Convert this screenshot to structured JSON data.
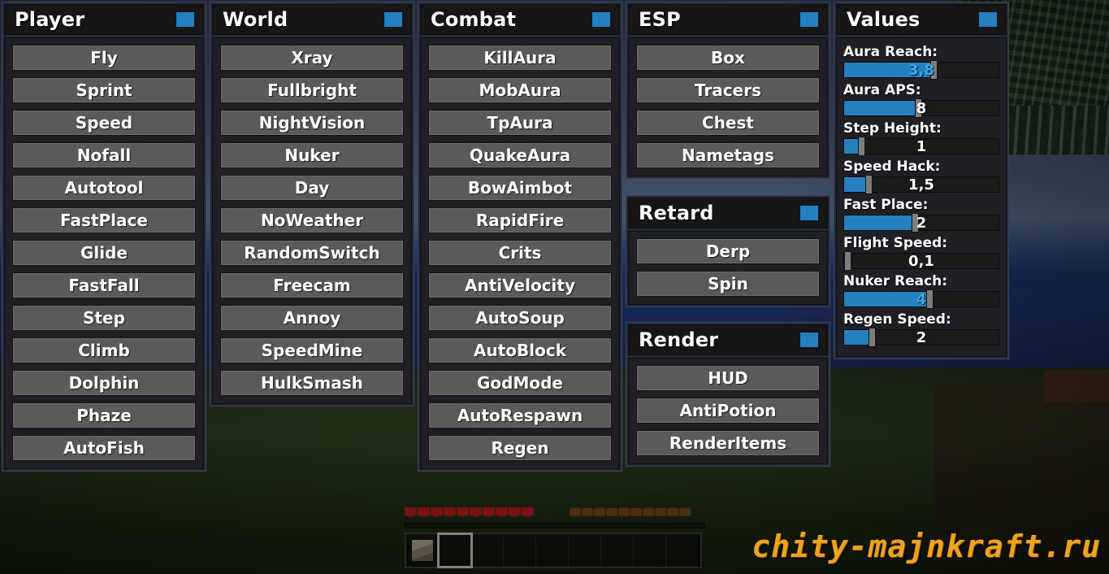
{
  "watermark": "chity-majnkraft.ru",
  "accent_color": "#2580c0",
  "panels": [
    {
      "id": "player",
      "title": "Player",
      "toggle_icon": "toggle-square-icon",
      "enabled": true,
      "modules": [
        "Fly",
        "Sprint",
        "Speed",
        "Nofall",
        "Autotool",
        "FastPlace",
        "Glide",
        "FastFall",
        "Step",
        "Climb",
        "Dolphin",
        "Phaze",
        "AutoFish"
      ]
    },
    {
      "id": "world",
      "title": "World",
      "toggle_icon": "toggle-square-icon",
      "enabled": true,
      "modules": [
        "Xray",
        "Fullbright",
        "NightVision",
        "Nuker",
        "Day",
        "NoWeather",
        "RandomSwitch",
        "Freecam",
        "Annoy",
        "SpeedMine",
        "HulkSmash"
      ]
    },
    {
      "id": "combat",
      "title": "Combat",
      "toggle_icon": "toggle-square-icon",
      "enabled": true,
      "modules": [
        "KillAura",
        "MobAura",
        "TpAura",
        "QuakeAura",
        "BowAimbot",
        "RapidFire",
        "Crits",
        "AntiVelocity",
        "AutoSoup",
        "AutoBlock",
        "GodMode",
        "AutoRespawn",
        "Regen"
      ]
    },
    {
      "id": "esp",
      "title": "ESP",
      "toggle_icon": "toggle-square-icon",
      "enabled": true,
      "modules": [
        "Box",
        "Tracers",
        "Chest",
        "Nametags"
      ]
    },
    {
      "id": "retard",
      "title": "Retard",
      "toggle_icon": "toggle-square-icon",
      "enabled": true,
      "modules": [
        "Derp",
        "Spin"
      ]
    },
    {
      "id": "render",
      "title": "Render",
      "toggle_icon": "toggle-square-icon",
      "enabled": true,
      "modules": [
        "HUD",
        "AntiPotion",
        "RenderItems"
      ]
    }
  ],
  "values_panel": {
    "title": "Values",
    "toggle_icon": "toggle-square-icon",
    "enabled": true,
    "sliders": [
      {
        "label": "Aura Reach:",
        "value": "3,8",
        "fill_percent": 58,
        "highlighted": true
      },
      {
        "label": "Aura APS:",
        "value": "8",
        "fill_percent": 48,
        "highlighted": false
      },
      {
        "label": "Step Height:",
        "value": "1",
        "fill_percent": 11,
        "highlighted": false
      },
      {
        "label": "Speed Hack:",
        "value": "1,5",
        "fill_percent": 16,
        "highlighted": false
      },
      {
        "label": "Fast Place:",
        "value": "2",
        "fill_percent": 46,
        "highlighted": false
      },
      {
        "label": "Flight Speed:",
        "value": "0,1",
        "fill_percent": 2,
        "highlighted": false
      },
      {
        "label": "Nuker Reach:",
        "value": "4",
        "fill_percent": 55,
        "highlighted": true
      },
      {
        "label": "Regen Speed:",
        "value": "2",
        "fill_percent": 18,
        "highlighted": false
      }
    ]
  },
  "hud": {
    "hearts": 10,
    "hunger": 10,
    "hotbar_slots": 9,
    "selected_slot": 2,
    "item_slot": 1,
    "item_name": "block-item"
  }
}
